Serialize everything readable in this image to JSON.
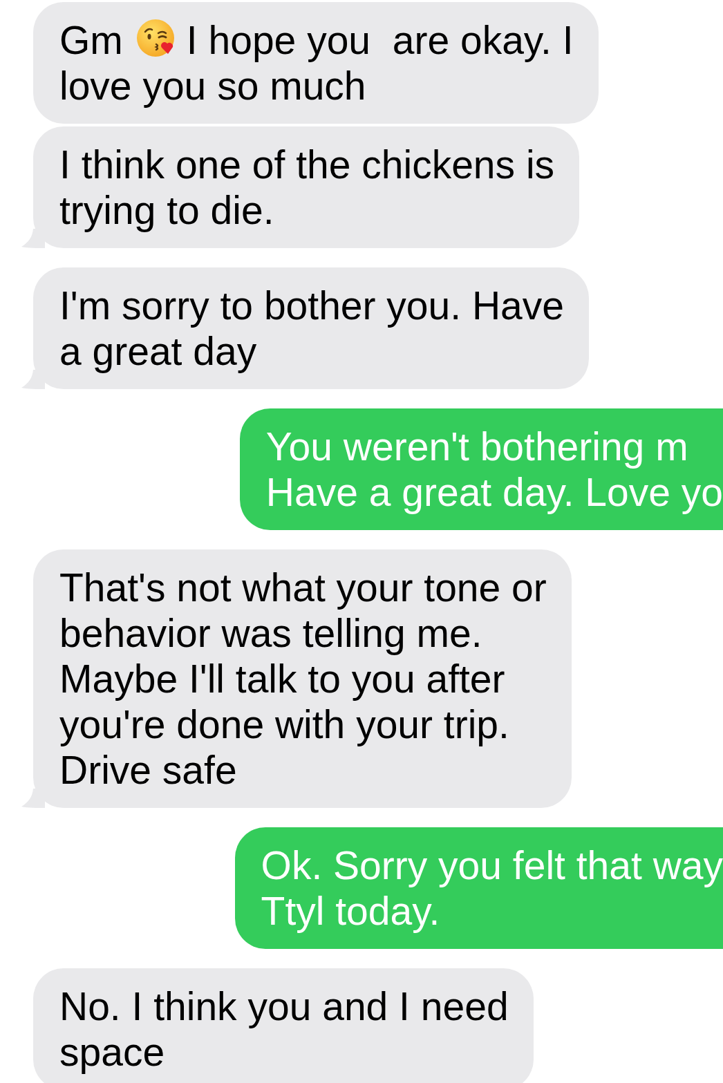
{
  "messages": [
    {
      "kind": "received",
      "tail": false,
      "lines": [
        [
          {
            "kind": "text",
            "text": "Gm"
          },
          {
            "kind": "emoji"
          },
          {
            "kind": "text",
            "text": "I hope you  are okay. I"
          }
        ],
        "love you so much"
      ]
    },
    {
      "kind": "received",
      "tail": true,
      "lines": [
        "I think one of the chickens is",
        "trying to die."
      ]
    },
    {
      "kind": "received",
      "tail": true,
      "lines": [
        "I'm sorry to bother you. Have",
        "a great day"
      ]
    },
    {
      "kind": "sent",
      "lines": [
        "You weren't bothering m",
        "Have a great day. Love yo"
      ]
    },
    {
      "kind": "received",
      "tail": true,
      "lines": [
        "That's not what your tone or",
        "behavior was telling me.",
        "Maybe I'll talk to you after",
        "you're done with your trip.",
        "Drive safe"
      ]
    },
    {
      "kind": "sent",
      "lines": [
        "Ok. Sorry you felt that way",
        "Ttyl today."
      ]
    },
    {
      "kind": "received",
      "tail": false,
      "lines": [
        "No. I think you and I need",
        "space"
      ]
    }
  ]
}
